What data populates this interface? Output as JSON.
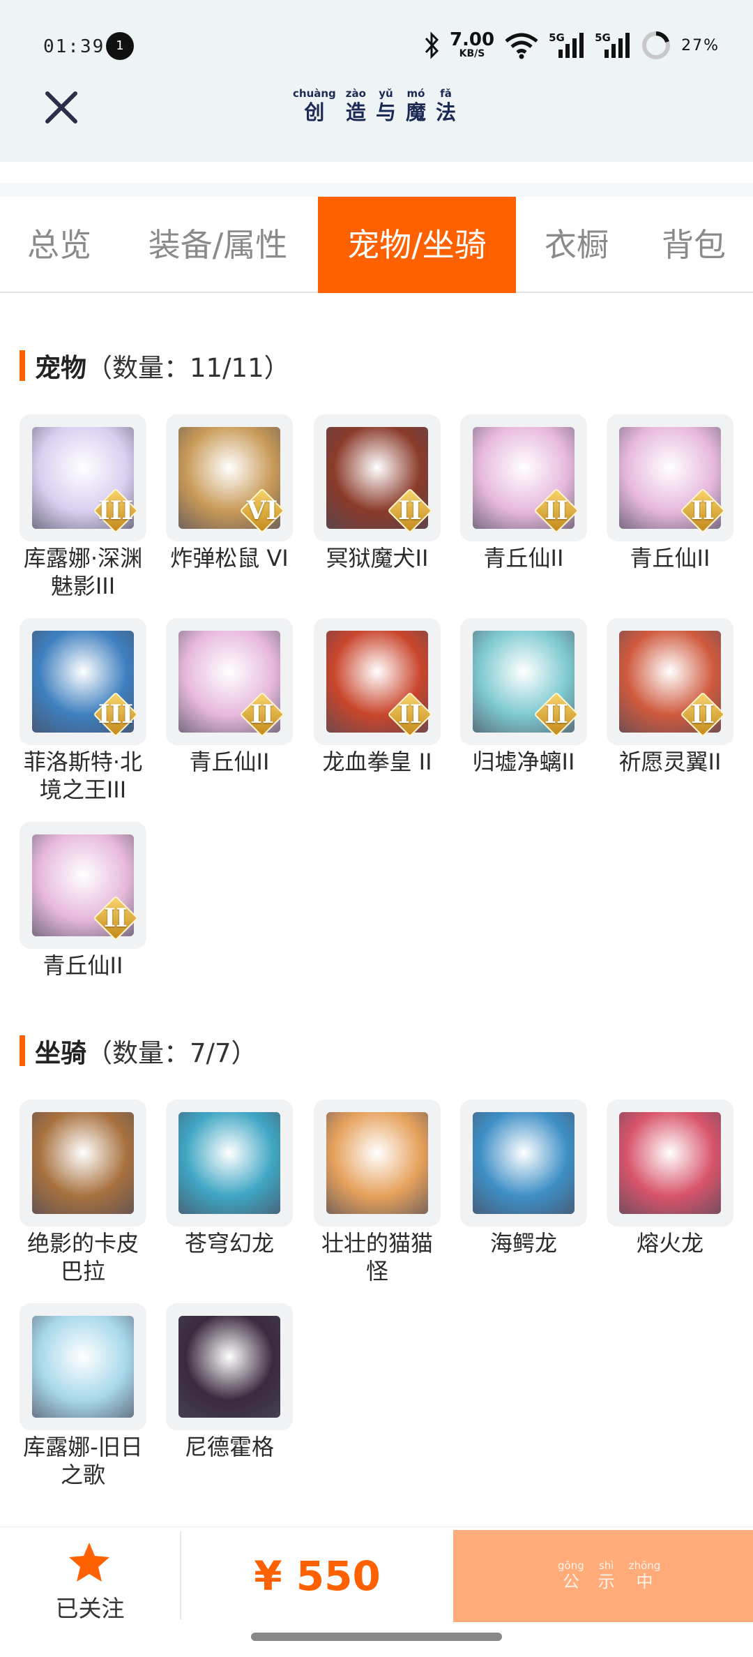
{
  "status_bar": {
    "time": "01:39",
    "notification_count": "1",
    "net_speed": "7.00",
    "net_unit": "KB/S",
    "signal1": "5G",
    "signal2": "5G",
    "battery": "27%"
  },
  "header": {
    "title_chars": [
      {
        "py": "chuàng",
        "ch": "创"
      },
      {
        "py": "zào",
        "ch": "造"
      },
      {
        "py": "yǔ",
        "ch": "与"
      },
      {
        "py": "mó",
        "ch": "魔"
      },
      {
        "py": "fǎ",
        "ch": "法"
      }
    ]
  },
  "tabs": [
    "总览",
    "装备/属性",
    "宠物/坐骑",
    "衣橱",
    "背包"
  ],
  "active_tab": "宠物/坐骑",
  "pets": {
    "title": "宠物",
    "count": "（数量：11/11）",
    "items": [
      {
        "name": "库露娜·深渊魅影III",
        "rank": "III",
        "color": "#d9cff0"
      },
      {
        "name": "炸弹松鼠 VI",
        "rank": "VI",
        "color": "#c99a58"
      },
      {
        "name": "冥狱魔犬II",
        "rank": "II",
        "color": "#8a3a2a"
      },
      {
        "name": "青丘仙II",
        "rank": "II",
        "color": "#e7b9dc"
      },
      {
        "name": "青丘仙II",
        "rank": "II",
        "color": "#e7b9dc"
      },
      {
        "name": "菲洛斯特·北境之王III",
        "rank": "III",
        "color": "#3e7fbf"
      },
      {
        "name": "青丘仙II",
        "rank": "II",
        "color": "#e7b9dc"
      },
      {
        "name": "龙血拳皇 II",
        "rank": "II",
        "color": "#c9452c"
      },
      {
        "name": "归墟净螭II",
        "rank": "II",
        "color": "#7fcad1"
      },
      {
        "name": "祈愿灵翼II",
        "rank": "II",
        "color": "#cf5a3e"
      },
      {
        "name": "青丘仙II",
        "rank": "II",
        "color": "#e7b9dc"
      }
    ]
  },
  "mounts": {
    "title": "坐骑",
    "count": "（数量：7/7）",
    "items": [
      {
        "name": "绝影的卡皮巴拉",
        "color": "#a8713f"
      },
      {
        "name": "苍穹幻龙",
        "color": "#3fa6c4"
      },
      {
        "name": "壮壮的猫猫怪",
        "color": "#e6a15c"
      },
      {
        "name": "海鳄龙",
        "color": "#3e8fc6"
      },
      {
        "name": "熔火龙",
        "color": "#d8546a"
      },
      {
        "name": "库露娜-旧日之歌",
        "color": "#a8d8ec"
      },
      {
        "name": "尼德霍格",
        "color": "#3a2a3e"
      }
    ]
  },
  "bottom": {
    "follow_label": "已关注",
    "price": "¥ 550",
    "action_chars": [
      {
        "py": "gōng",
        "ch": "公"
      },
      {
        "py": "shì",
        "ch": "示"
      },
      {
        "py": "zhōng",
        "ch": "中"
      }
    ]
  }
}
